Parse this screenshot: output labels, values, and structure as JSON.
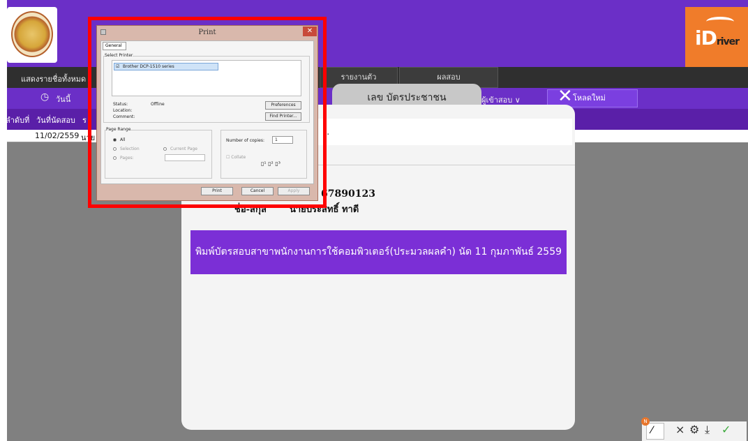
{
  "header": {
    "brand_text": "iD",
    "brand_sub": "river"
  },
  "nav": {
    "show_all": "แสดงรายชื่อทั้งหมด",
    "tab_report": "รายงานตัว",
    "tab_result": "ผลสอบ",
    "date_label": "วันนี้",
    "filter_entrant": "ผู้เข้าสอบ",
    "reload": "โหลดใหม่"
  },
  "table": {
    "headers": [
      "ลำดับที่",
      "วันที่นัดสอบ",
      "ร"
    ],
    "row": [
      "11/02/2559",
      "นาย"
    ]
  },
  "modal": {
    "tab_title": "เลข บัตรประชาชน",
    "field_text": "..",
    "id_value": "67890123",
    "name_label": "ชื่อ-สกุล",
    "name_value": "นายประสิทธิ์ ทาดี",
    "print_button": "พิมพ์บัตรสอบสาขาพนักงานการใช้คอมพิวเตอร์(ประมวลผลคำ) นัด 11 กุมภาพันธ์ 2559"
  },
  "print_dialog": {
    "title": "Print",
    "tab": "General",
    "select_printer": "Select Printer",
    "printer_name": "Brother DCP-1510 series",
    "status_label": "Status:",
    "status_value": "Offline",
    "location_label": "Location:",
    "comment_label": "Comment:",
    "preferences": "Preferences",
    "find_printer": "Find Printer...",
    "page_range": "Page Range",
    "all": "All",
    "selection": "Selection",
    "current_page": "Current Page",
    "pages": "Pages:",
    "copies_label": "Number of copies:",
    "copies_value": "1",
    "collate": "Collate",
    "print": "Print",
    "cancel": "Cancel",
    "apply": "Apply"
  },
  "toolbar": {
    "badge": "N",
    "close": "×",
    "settings": "⚙",
    "download": "⤓",
    "check": "✓"
  }
}
